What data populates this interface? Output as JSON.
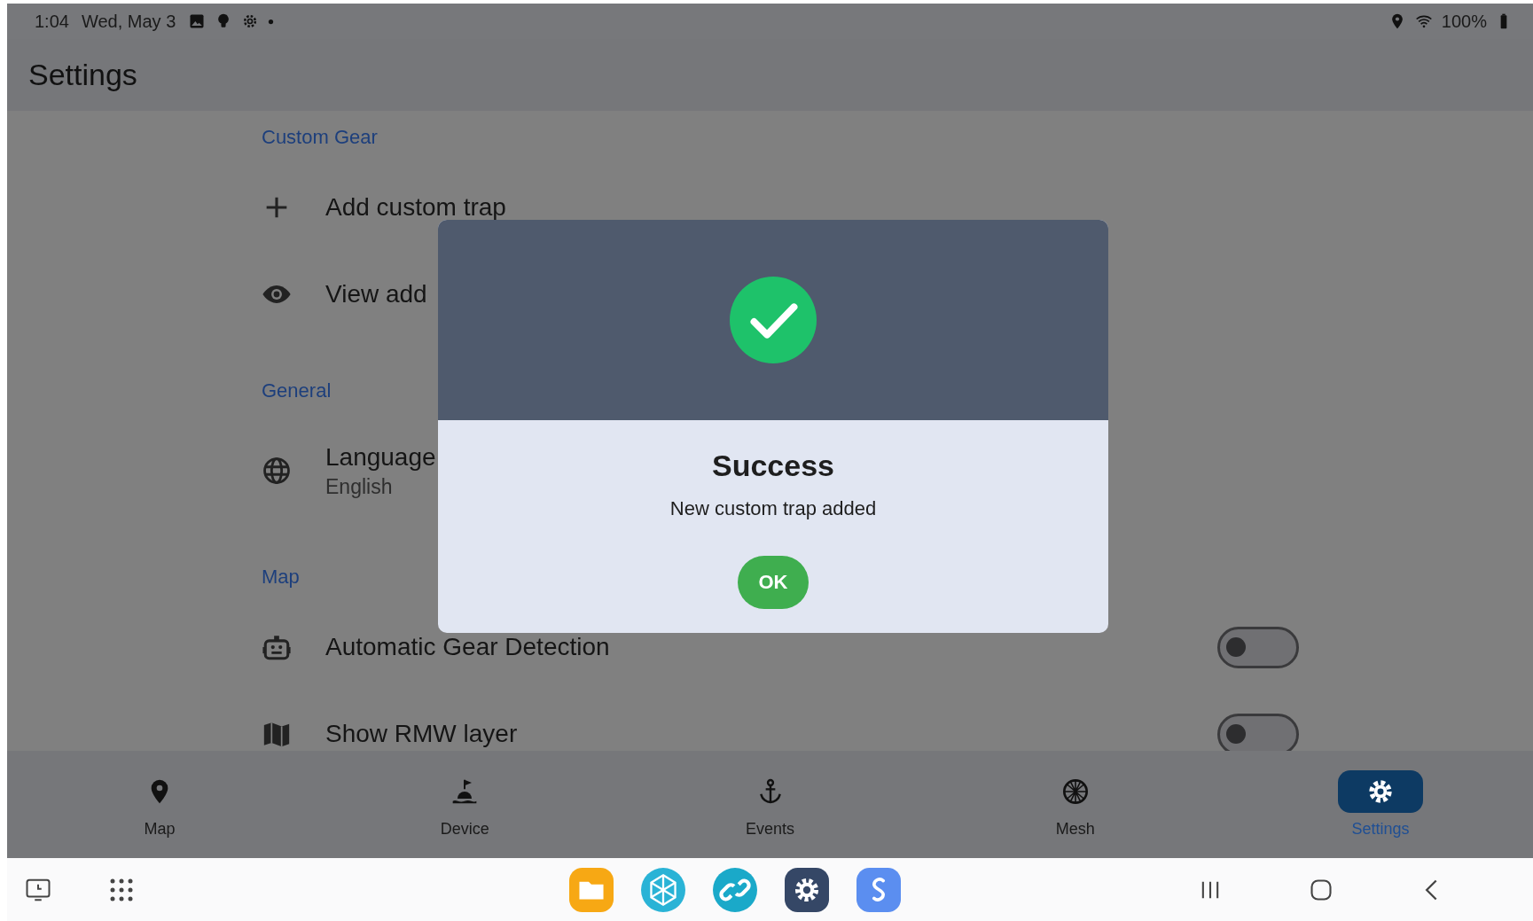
{
  "status_bar": {
    "time": "1:04",
    "date": "Wed, May 3",
    "battery": "100%"
  },
  "app_bar": {
    "title": "Settings"
  },
  "sections": [
    {
      "title": "Custom Gear",
      "items": [
        {
          "kind": "action",
          "label": "Add custom trap"
        },
        {
          "kind": "action",
          "label": "View add"
        }
      ]
    },
    {
      "title": "General",
      "items": [
        {
          "kind": "value",
          "label": "Language",
          "value": "English"
        }
      ]
    },
    {
      "title": "Map",
      "items": [
        {
          "kind": "toggle",
          "label": "Automatic Gear Detection",
          "on": false
        },
        {
          "kind": "toggle",
          "label": "Show RMW layer",
          "on": false
        }
      ]
    }
  ],
  "dialog": {
    "title": "Success",
    "message": "New custom trap added",
    "button": "OK"
  },
  "bottom_nav": [
    {
      "label": "Map",
      "selected": false
    },
    {
      "label": "Device",
      "selected": false
    },
    {
      "label": "Events",
      "selected": false
    },
    {
      "label": "Mesh",
      "selected": false
    },
    {
      "label": "Settings",
      "selected": true
    }
  ]
}
